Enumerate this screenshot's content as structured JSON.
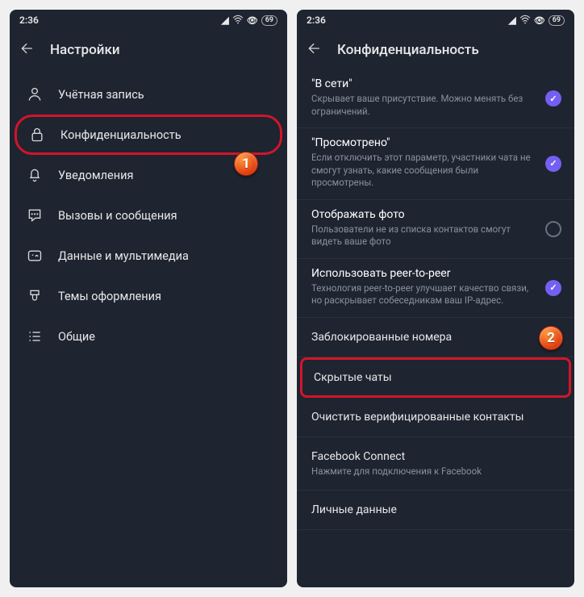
{
  "statusbar": {
    "time": "2:36",
    "battery": "69"
  },
  "left": {
    "title": "Настройки",
    "items": [
      {
        "label": "Учётная запись"
      },
      {
        "label": "Конфиденциальность"
      },
      {
        "label": "Уведомления"
      },
      {
        "label": "Вызовы и сообщения"
      },
      {
        "label": "Данные и мультимедиа"
      },
      {
        "label": "Темы оформления"
      },
      {
        "label": "Общие"
      }
    ],
    "badge": "1"
  },
  "right": {
    "title": "Конфиденциальность",
    "sections": [
      {
        "title": "\"В сети\"",
        "desc": "Скрывает ваше присутствие. Можно менять без ограничений.",
        "on": true
      },
      {
        "title": "\"Просмотрено\"",
        "desc": "Если отключить этот параметр, участники чата не смогут узнать, какие сообщения были просмотрены.",
        "on": true
      },
      {
        "title": "Отображать фото",
        "desc": "Пользователи не из списка контактов смогут видеть ваше фото",
        "on": false
      },
      {
        "title": "Использовать peer-to-peer",
        "desc": "Технология peer-to-peer улучшает качество связи, но раскрывает собеседникам ваш IP-адрес.",
        "on": true
      }
    ],
    "rows": {
      "blocked": "Заблокированные номера",
      "hidden": "Скрытые чаты",
      "clear": "Очистить верифицированные контакты",
      "fb_title": "Facebook Connect",
      "fb_desc": "Нажмите для подключения к Facebook",
      "personal": "Личные данные"
    },
    "badge": "2"
  }
}
